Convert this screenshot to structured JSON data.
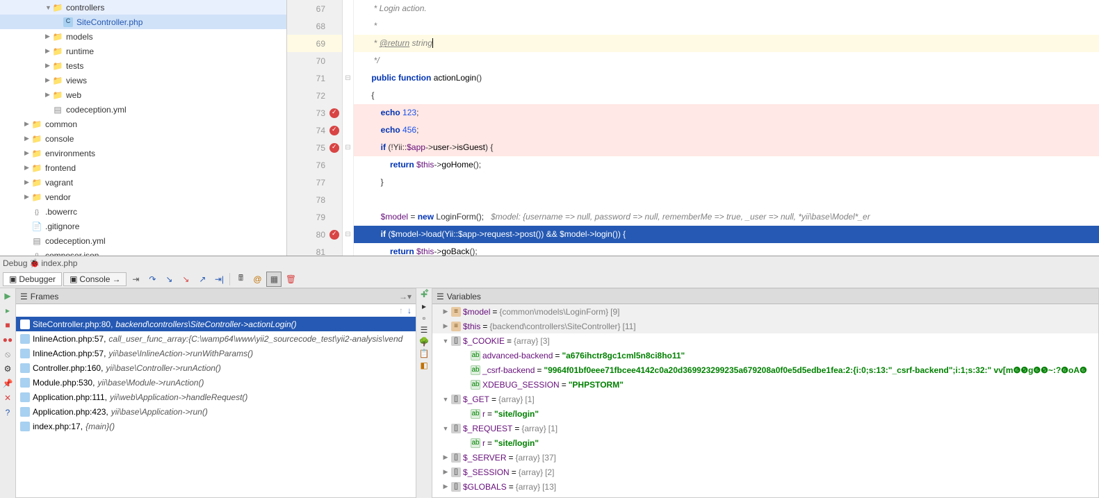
{
  "project_tree": [
    {
      "indent": 65,
      "arrow": "▼",
      "icon": "folder",
      "label": "controllers"
    },
    {
      "indent": 80,
      "arrow": "",
      "icon": "php",
      "label": "SiteController.php",
      "selected": true
    },
    {
      "indent": 65,
      "arrow": "▶",
      "icon": "folder",
      "label": "models"
    },
    {
      "indent": 65,
      "arrow": "▶",
      "icon": "folder",
      "label": "runtime"
    },
    {
      "indent": 65,
      "arrow": "▶",
      "icon": "folder",
      "label": "tests"
    },
    {
      "indent": 65,
      "arrow": "▶",
      "icon": "folder",
      "label": "views"
    },
    {
      "indent": 65,
      "arrow": "▶",
      "icon": "folder",
      "label": "web"
    },
    {
      "indent": 65,
      "arrow": "",
      "icon": "yml",
      "label": "codeception.yml"
    },
    {
      "indent": 35,
      "arrow": "▶",
      "icon": "folder",
      "label": "common"
    },
    {
      "indent": 35,
      "arrow": "▶",
      "icon": "folder",
      "label": "console"
    },
    {
      "indent": 35,
      "arrow": "▶",
      "icon": "folder",
      "label": "environments"
    },
    {
      "indent": 35,
      "arrow": "▶",
      "icon": "folder",
      "label": "frontend"
    },
    {
      "indent": 35,
      "arrow": "▶",
      "icon": "folder",
      "label": "vagrant"
    },
    {
      "indent": 35,
      "arrow": "▶",
      "icon": "folder",
      "label": "vendor"
    },
    {
      "indent": 35,
      "arrow": "",
      "icon": "json",
      "label": ".bowerrc"
    },
    {
      "indent": 35,
      "arrow": "",
      "icon": "file",
      "label": ".gitignore"
    },
    {
      "indent": 35,
      "arrow": "",
      "icon": "yml",
      "label": "codeception.yml"
    },
    {
      "indent": 35,
      "arrow": "",
      "icon": "json",
      "label": "composer.json"
    }
  ],
  "editor": {
    "lines": [
      {
        "n": 67,
        "html": "     * Login action.",
        "cls": "cm"
      },
      {
        "n": 68,
        "html": "     *",
        "cls": "cm"
      },
      {
        "n": 69,
        "html": "     * @return string",
        "cls": "cm",
        "current": true,
        "caret": true
      },
      {
        "n": 70,
        "html": "     */",
        "cls": "cm"
      },
      {
        "n": 71,
        "html": "    public function actionLogin()",
        "cls": ""
      },
      {
        "n": 72,
        "html": "    {",
        "cls": ""
      },
      {
        "n": 73,
        "html": "        echo 123;",
        "cls": "",
        "bp": true
      },
      {
        "n": 74,
        "html": "        echo 456;",
        "cls": "",
        "bp": true
      },
      {
        "n": 75,
        "html": "        if (!Yii::$app->user->isGuest) {",
        "cls": "",
        "bp": true
      },
      {
        "n": 76,
        "html": "            return $this->goHome();",
        "cls": ""
      },
      {
        "n": 77,
        "html": "        }",
        "cls": ""
      },
      {
        "n": 78,
        "html": "",
        "cls": ""
      },
      {
        "n": 79,
        "html": "        $model = new LoginForm();   $model: {username => null, password => null, rememberMe => true, _user => null, *yii\\base\\Model*_er",
        "cls": ""
      },
      {
        "n": 80,
        "html": "        if ($model->load(Yii::$app->request->post()) && $model->login()) {",
        "cls": "",
        "bp": true,
        "exec": true
      },
      {
        "n": 81,
        "html": "            return $this->goBack();",
        "cls": ""
      }
    ]
  },
  "debug": {
    "tab_title": "Debug",
    "session": "index.php",
    "toolbar": {
      "debugger": "Debugger",
      "console": "Console"
    },
    "frames_title": "Frames",
    "frames": [
      {
        "file": "SiteController.php:80,",
        "ctx": "backend\\controllers\\SiteController->actionLogin()",
        "sel": true
      },
      {
        "file": "InlineAction.php:57,",
        "ctx": "call_user_func_array:{C:\\wamp64\\www\\yii2_sourcecode_test\\yii2-analysis\\vend"
      },
      {
        "file": "InlineAction.php:57,",
        "ctx": "yii\\base\\InlineAction->runWithParams()"
      },
      {
        "file": "Controller.php:160,",
        "ctx": "yii\\base\\Controller->runAction()"
      },
      {
        "file": "Module.php:530,",
        "ctx": "yii\\base\\Module->runAction()"
      },
      {
        "file": "Application.php:111,",
        "ctx": "yii\\web\\Application->handleRequest()"
      },
      {
        "file": "Application.php:423,",
        "ctx": "yii\\base\\Application->run()"
      },
      {
        "file": "index.php:17,",
        "ctx": "{main}()"
      }
    ],
    "vars_title": "Variables",
    "vars": [
      {
        "indent": 8,
        "arrow": "▶",
        "icon": "obj",
        "name": "$model",
        "eq": " = ",
        "type": "{common\\models\\LoginForm}",
        "cnt": " [9]",
        "light": true
      },
      {
        "indent": 8,
        "arrow": "▶",
        "icon": "obj",
        "name": "$this",
        "eq": " = ",
        "type": "{backend\\controllers\\SiteController}",
        "cnt": " [11]",
        "light": true
      },
      {
        "indent": 8,
        "arrow": "▼",
        "icon": "arr",
        "name": "$_COOKIE",
        "eq": " = ",
        "type": "{array}",
        "cnt": " [3]"
      },
      {
        "indent": 36,
        "arrow": "",
        "icon": "str",
        "name": "advanced-backend",
        "eq": " = ",
        "val": "\"a676ihctr8gc1cml5n8ci8ho11\""
      },
      {
        "indent": 36,
        "arrow": "",
        "icon": "str",
        "name": "_csrf-backend",
        "eq": " = ",
        "val": "\"9964f01bf0eee71fbcee4142c0a20d369923299235a679208a0f0e5d5edbe1fea:2:{i:0;s:13:\"_csrf-backend\";i:1;s:32:\" vv[m❻❺g❻❺~:?❻oA❻"
      },
      {
        "indent": 36,
        "arrow": "",
        "icon": "str",
        "name": "XDEBUG_SESSION",
        "eq": " = ",
        "val": "\"PHPSTORM\""
      },
      {
        "indent": 8,
        "arrow": "▼",
        "icon": "arr",
        "name": "$_GET",
        "eq": " = ",
        "type": "{array}",
        "cnt": " [1]"
      },
      {
        "indent": 36,
        "arrow": "",
        "icon": "str",
        "name": "r",
        "eq": " = ",
        "val": "\"site/login\""
      },
      {
        "indent": 8,
        "arrow": "▼",
        "icon": "arr",
        "name": "$_REQUEST",
        "eq": " = ",
        "type": "{array}",
        "cnt": " [1]"
      },
      {
        "indent": 36,
        "arrow": "",
        "icon": "str",
        "name": "r",
        "eq": " = ",
        "val": "\"site/login\""
      },
      {
        "indent": 8,
        "arrow": "▶",
        "icon": "arr",
        "name": "$_SERVER",
        "eq": " = ",
        "type": "{array}",
        "cnt": " [37]"
      },
      {
        "indent": 8,
        "arrow": "▶",
        "icon": "arr",
        "name": "$_SESSION",
        "eq": " = ",
        "type": "{array}",
        "cnt": " [2]"
      },
      {
        "indent": 8,
        "arrow": "▶",
        "icon": "arr",
        "name": "$GLOBALS",
        "eq": " = ",
        "type": "{array}",
        "cnt": " [13]"
      }
    ]
  }
}
